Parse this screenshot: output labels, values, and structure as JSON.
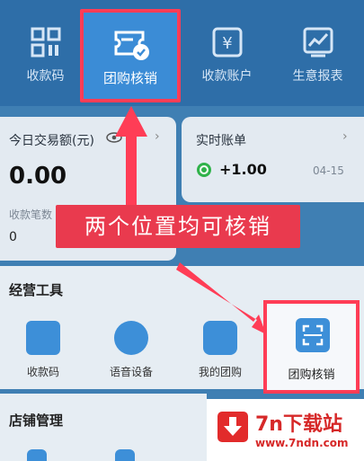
{
  "top_nav": {
    "items": [
      {
        "label": "收款码",
        "icon": "qr-grid-icon"
      },
      {
        "label": "团购核销",
        "icon": "ticket-check-icon",
        "highlighted": true
      },
      {
        "label": "收款账户",
        "icon": "yuan-card-icon"
      },
      {
        "label": "生意报表",
        "icon": "chart-icon"
      }
    ]
  },
  "today": {
    "title": "今日交易额(元)",
    "amount": "0.00",
    "count_label": "收款笔数",
    "count_value": "0"
  },
  "realtime": {
    "title": "实时账单",
    "amount": "+1.00",
    "date": "04-15"
  },
  "annotation": {
    "text": "两个位置均可核销"
  },
  "tools": {
    "title": "经营工具",
    "items": [
      {
        "label": "收款码"
      },
      {
        "label": "语音设备"
      },
      {
        "label": "我的团购"
      },
      {
        "label": "团购核销",
        "highlighted": true
      }
    ]
  },
  "shop": {
    "title": "店铺管理"
  },
  "watermark": {
    "brand": "7n下载站",
    "url": "www.7ndn.com"
  },
  "colors": {
    "highlight": "#ff3d56",
    "header": "#2e6ea8",
    "green": "#2fb24a"
  }
}
